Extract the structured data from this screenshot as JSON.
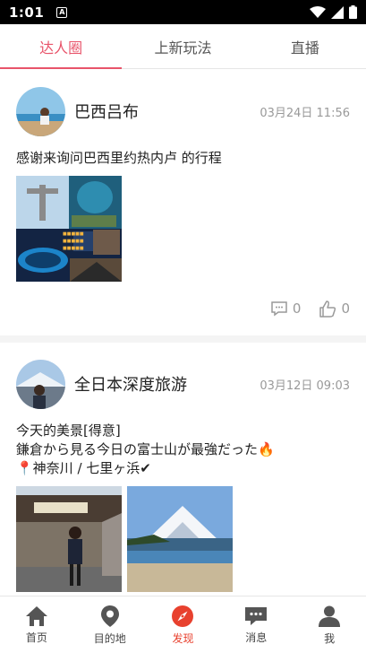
{
  "status_bar": {
    "time": "1:01",
    "notification_badge": "A"
  },
  "tabs": [
    {
      "label": "达人圈",
      "active": true
    },
    {
      "label": "上新玩法",
      "active": false
    },
    {
      "label": "直播",
      "active": false
    }
  ],
  "posts": [
    {
      "author": "巴西吕布",
      "date": "03月24日 11:56",
      "text": "感谢来询问巴西里约热内卢 的行程",
      "comments": "0",
      "likes": "0"
    },
    {
      "author": "全日本深度旅游",
      "date": "03月12日 09:03",
      "text": "今天的美景[得意]\n鎌倉から見る今日の富士山が最強だった🔥\n📍神奈川 / 七里ヶ浜✔"
    }
  ],
  "bottom_nav": [
    {
      "label": "首页",
      "icon": "home-icon",
      "active": false
    },
    {
      "label": "目的地",
      "icon": "location-pin-icon",
      "active": false
    },
    {
      "label": "发现",
      "icon": "compass-icon",
      "active": true
    },
    {
      "label": "消息",
      "icon": "chat-bubble-icon",
      "active": false
    },
    {
      "label": "我",
      "icon": "person-icon",
      "active": false
    }
  ],
  "colors": {
    "accent": "#e8546a",
    "nav_active": "#e8412e"
  }
}
